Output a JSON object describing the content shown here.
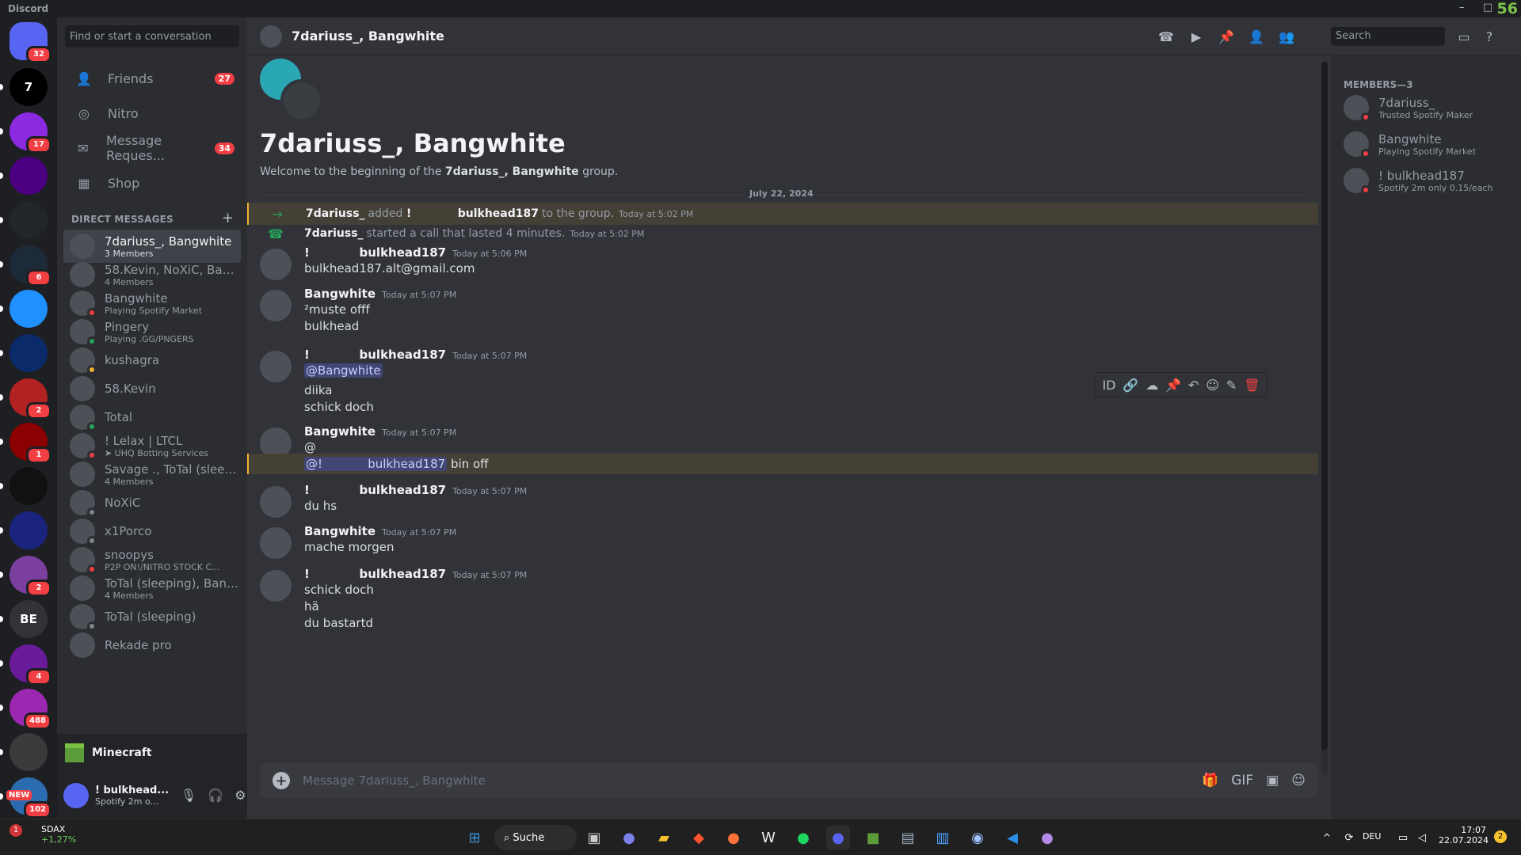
{
  "window": {
    "title": "Discord",
    "fps": "56"
  },
  "servers": [
    {
      "label": "",
      "badge": "32",
      "color": "#5865f2"
    },
    {
      "label": "7",
      "badge": "",
      "color": "#000000"
    },
    {
      "label": "",
      "badge": "17",
      "color": "#8a2be2"
    },
    {
      "label": "",
      "badge": "",
      "color": "#4b0082"
    },
    {
      "label": "",
      "badge": "",
      "color": "#22252a"
    },
    {
      "label": "",
      "badge": "6",
      "color": "#1c2a3a"
    },
    {
      "label": "",
      "badge": "",
      "color": "#1e90ff"
    },
    {
      "label": "",
      "badge": "",
      "color": "#0b2a6a"
    },
    {
      "label": "",
      "badge": "2",
      "color": "#b22222"
    },
    {
      "label": "",
      "badge": "1",
      "color": "#8b0000"
    },
    {
      "label": "",
      "badge": "",
      "color": "#111111"
    },
    {
      "label": "",
      "badge": "",
      "color": "#1a237e"
    },
    {
      "label": "",
      "badge": "2",
      "color": "#7b3fa0"
    },
    {
      "label": "BE",
      "badge": "",
      "color": "#313338"
    },
    {
      "label": "",
      "badge": "4",
      "color": "#6a1b9a"
    },
    {
      "label": "",
      "badge": "488",
      "color": "#9c27b0"
    },
    {
      "label": "",
      "badge": "",
      "color": "#3a3a3a"
    },
    {
      "label": "",
      "badge": "102",
      "color": "#2b6cb0",
      "new": "NEW"
    }
  ],
  "dm_search_placeholder": "Find or start a conversation",
  "topnav": [
    {
      "label": "Friends",
      "badge": "27",
      "icon": "friends-icon"
    },
    {
      "label": "Nitro",
      "badge": "",
      "icon": "nitro-icon"
    },
    {
      "label": "Message Reques...",
      "badge": "34",
      "icon": "mail-icon"
    },
    {
      "label": "Shop",
      "badge": "",
      "icon": "shop-icon"
    }
  ],
  "dm_header": "DIRECT MESSAGES",
  "dms": [
    {
      "name": "7dariuss_, Bangwhite",
      "sub": "3 Members",
      "status": "",
      "selected": true
    },
    {
      "name": "58.Kevin, NoXiC, Ban...",
      "sub": "4 Members",
      "status": ""
    },
    {
      "name": "Bangwhite",
      "sub": "Playing Spotify Market",
      "status": "dnd"
    },
    {
      "name": "Pingery",
      "sub": "Playing .GG/PNGERS",
      "status": "online"
    },
    {
      "name": "kushagra",
      "sub": "",
      "status": "idle"
    },
    {
      "name": "58.Kevin",
      "sub": "",
      "status": ""
    },
    {
      "name": "Total",
      "sub": "",
      "status": "online"
    },
    {
      "name": "! Lelax | LTCL",
      "sub": "➤ UHQ Botting Services",
      "status": "dnd"
    },
    {
      "name": "Savage ., ToTal (sleepi...",
      "sub": "4 Members",
      "status": ""
    },
    {
      "name": "NoXiC",
      "sub": "",
      "status": "offline"
    },
    {
      "name": "x1Porco",
      "sub": "",
      "status": "offline"
    },
    {
      "name": "snoopys",
      "sub": "P2P ON!/NITRO STOCK C...",
      "status": "dnd"
    },
    {
      "name": "ToTal (sleeping), Bang...",
      "sub": "4 Members",
      "status": ""
    },
    {
      "name": "ToTal (sleeping)",
      "sub": "",
      "status": "offline"
    },
    {
      "name": "Rekade pro",
      "sub": "",
      "status": ""
    }
  ],
  "activity_bar": {
    "label": "Minecraft"
  },
  "user": {
    "name": "! bulkhead...",
    "sub": "Spotify 2m o..."
  },
  "chat": {
    "header_title": "7dariuss_, Bangwhite",
    "search_placeholder": "Search",
    "group_name": "7dariuss_, Bangwhite",
    "welcome_prefix": "Welcome to the beginning of the ",
    "welcome_name": "7dariuss_, Bangwhite",
    "welcome_suffix": " group.",
    "date_divider": "July 22, 2024",
    "system": [
      {
        "actor": "7dariuss_",
        "text_a": "added",
        "target": "!            bulkhead187",
        "text_b": "to the group.",
        "time": "Today at 5:02 PM"
      },
      {
        "actor": "7dariuss_",
        "text_a": "started a call that lasted 4 minutes.",
        "target": "",
        "text_b": "",
        "time": "Today at 5:02 PM"
      }
    ],
    "messages": [
      {
        "author": "!            bulkhead187",
        "time": "Today at 5:06 PM",
        "lines": [
          "bulkhead187.alt@gmail.com"
        ]
      },
      {
        "author": "Bangwhite",
        "time": "Today at 5:07 PM",
        "lines": [
          "²muste offf",
          "bulkhead"
        ]
      },
      {
        "author": "!            bulkhead187",
        "time": "Today at 5:07 PM",
        "mention": "@Bangwhite",
        "lines": [
          "diika",
          "schick doch"
        ]
      },
      {
        "author": "Bangwhite",
        "time": "Today at 5:07 PM",
        "lines": [
          "@"
        ],
        "hl_mention": "@!            bulkhead187",
        "hl_text": "bin off"
      },
      {
        "author": "!            bulkhead187",
        "time": "Today at 5:07 PM",
        "lines": [
          "du hs"
        ]
      },
      {
        "author": "Bangwhite",
        "time": "Today at 5:07 PM",
        "lines": [
          "mache morgen"
        ]
      },
      {
        "author": "!            bulkhead187",
        "time": "Today at 5:07 PM",
        "lines": [
          "schick doch",
          "hä",
          "du bastartd"
        ]
      }
    ],
    "composer_placeholder": "Message 7dariuss_, Bangwhite"
  },
  "members": {
    "header": "MEMBERS—3",
    "list": [
      {
        "name": "7dariuss_",
        "sub": "Trusted Spotify Maker"
      },
      {
        "name": "Bangwhite",
        "sub": "Playing Spotify Market"
      },
      {
        "name": "! bulkhead187",
        "sub": "Spotify 2m only 0.15/each"
      }
    ]
  },
  "taskbar": {
    "stock_name": "SDAX",
    "stock_change": "+1,27%",
    "stock_badge": "1",
    "search_label": "Suche",
    "language": "DEU",
    "time": "17:07",
    "date": "22.07.2024",
    "notif": "2"
  },
  "colors": {
    "accent": "#5865f2",
    "danger": "#f23f43",
    "highlight": "#f0b232"
  }
}
